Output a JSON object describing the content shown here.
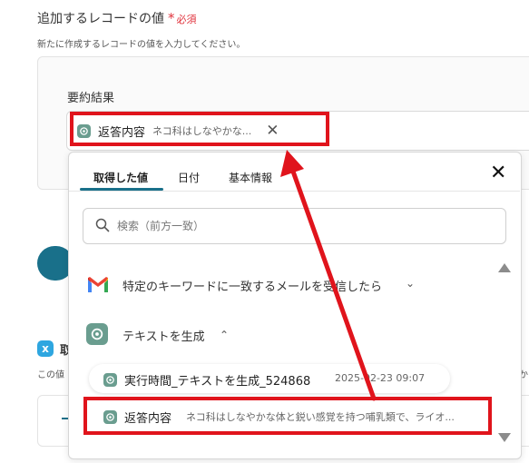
{
  "section": {
    "title": "追加するレコードの値",
    "required_star": "*",
    "required_text": "必須",
    "description": "新たに作成するレコードの値を入力してください。"
  },
  "field": {
    "label": "要約結果",
    "chip_label": "返答内容",
    "chip_value": "ネコ科はしなやかな...",
    "chip_remove": "✕"
  },
  "background": {
    "partial_title": "取",
    "partial_desc": "この値",
    "partial_right": "か"
  },
  "popup": {
    "tabs": [
      {
        "label": "取得した値"
      },
      {
        "label": "日付"
      },
      {
        "label": "基本情報"
      }
    ],
    "close": "✕",
    "search_placeholder": "検索（前方一致）",
    "groups": [
      {
        "label": "特定のキーワードに一致するメールを受信したら",
        "chevron": "⌄",
        "icon": "gmail-icon"
      },
      {
        "label": "テキストを生成",
        "chevron": "⌃",
        "icon": "chatgpt-icon"
      }
    ],
    "items": [
      {
        "label": "実行時間_テキストを生成_524868",
        "value": "2025-02-23 09:07"
      },
      {
        "label": "返答内容",
        "value": "ネコ科はしなやかな体と鋭い感覚を持つ哺乳類で、ライオ..."
      }
    ]
  },
  "colors": {
    "accent": "#19708a",
    "highlight": "#e0141c",
    "required": "#e0323c",
    "chatgpt": "#6a9d8f"
  }
}
